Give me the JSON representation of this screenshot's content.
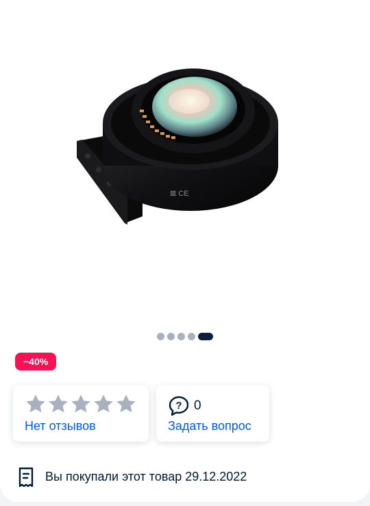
{
  "gallery": {
    "image_alt": "Lens mount adapter",
    "slide_count": 5,
    "active_slide": 5
  },
  "discount": {
    "label": "−40%",
    "color": "#f91155"
  },
  "reviews": {
    "rating": 0,
    "max_rating": 5,
    "link_label": "Нет отзывов",
    "star_color": "#a8b1bd"
  },
  "questions": {
    "count": "0",
    "link_label": "Задать вопрос"
  },
  "purchase": {
    "text": "Вы покупали этот товар 29.12.2022"
  },
  "colors": {
    "link": "#005bff",
    "text": "#001a34",
    "dot_active": "#0c1e3c",
    "dot": "#a8b1bd"
  }
}
